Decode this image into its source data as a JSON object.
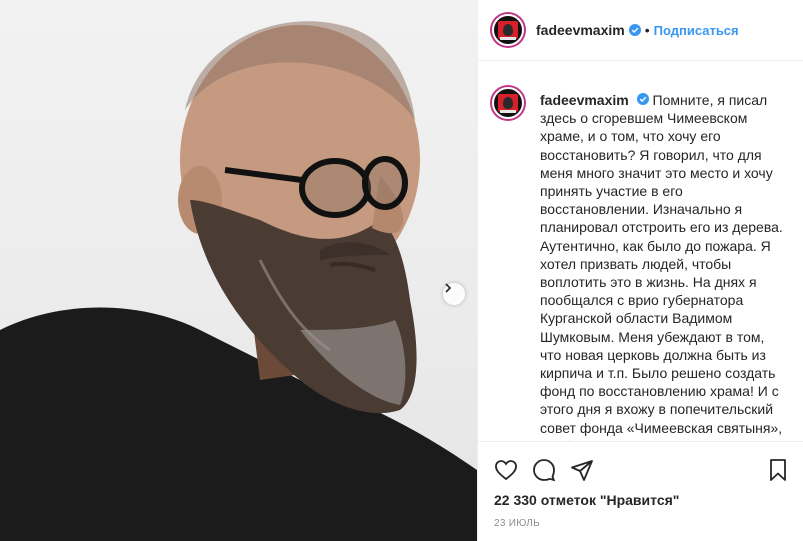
{
  "post": {
    "author": "fadeevmaxim",
    "follow_label": "Подписаться",
    "separator": "•",
    "caption": "Помните, я писал здесь о сгоревшем Чимеевском храме, и о том, что хочу его восстановить? Я говорил, что для меня много значит это место и хочу принять участие в его восстановлении. Изначально я планировал отстроить его из дерева. Аутентично, как было до пожара. Я хотел призвать людей, чтобы воплотить это в жизнь. На днях я пообщался с врио губернатора Курганской области Вадимом Шумковым. Меня убеждают в том, что новая церковь должна быть из кирпича и т.п. Было решено создать фонд по восстановлению храма! И с этого дня я вхожу в попечительский совет фонда «Чимеевская святыня», чтобы",
    "likes": "22 330 отметок \"Нравится\"",
    "date": "23 ИЮЛЬ"
  },
  "icons": {
    "verified": "verified-badge-icon",
    "like": "heart-icon",
    "comment": "comment-icon",
    "share": "share-icon",
    "save": "bookmark-icon",
    "next": "chevron-right-icon"
  },
  "colors": {
    "link": "#3897f0",
    "text": "#262626",
    "muted": "#8e8e8e",
    "border": "#efefef"
  }
}
